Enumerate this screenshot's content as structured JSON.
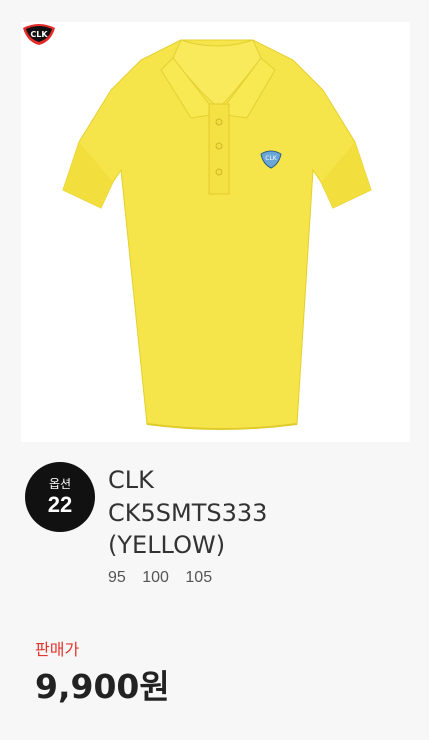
{
  "option": {
    "label": "옵션",
    "number": "22"
  },
  "product": {
    "brand": "CLK",
    "model_line1": "CK5SMTS333",
    "model_line2": "(YELLOW)",
    "sizes": [
      "95",
      "100",
      "105"
    ],
    "image_icon": "yellow-polo-shirt",
    "logo_text": "CLK"
  },
  "price": {
    "label": "판매가",
    "value": "9,900원"
  },
  "colors": {
    "shirt": "#f6e54a",
    "accent": "#e5342d",
    "badge": "#111111"
  }
}
